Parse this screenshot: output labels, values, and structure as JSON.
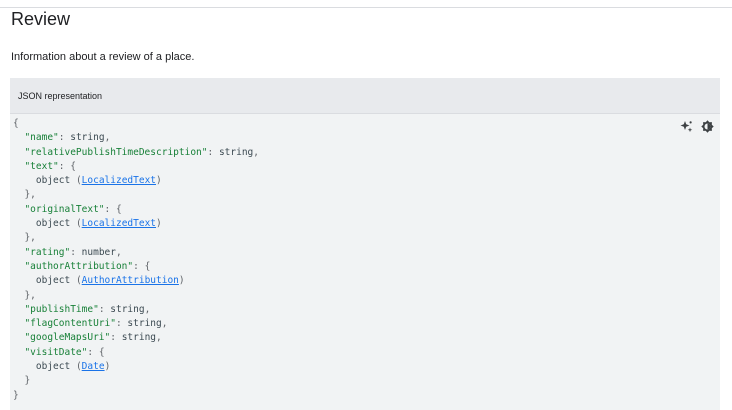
{
  "page": {
    "title": "Review",
    "description": "Information about a review of a place."
  },
  "panel": {
    "header": "JSON representation",
    "tools": [
      {
        "icon": "sparkle-icon"
      },
      {
        "icon": "dark-mode-toggle-icon"
      }
    ],
    "code": {
      "open_brace": "{",
      "close_brace": "}",
      "fields": {
        "name": {
          "key": "\"name\"",
          "type": "string"
        },
        "relativePublishTimeDescription": {
          "key": "\"relativePublishTimeDescription\"",
          "type": "string"
        },
        "text": {
          "key": "\"text\"",
          "object_word": "object",
          "link": "LocalizedText"
        },
        "originalText": {
          "key": "\"originalText\"",
          "object_word": "object",
          "link": "LocalizedText"
        },
        "rating": {
          "key": "\"rating\"",
          "type": "number"
        },
        "authorAttribution": {
          "key": "\"authorAttribution\"",
          "object_word": "object",
          "link": "AuthorAttribution"
        },
        "publishTime": {
          "key": "\"publishTime\"",
          "type": "string"
        },
        "flagContentUri": {
          "key": "\"flagContentUri\"",
          "type": "string"
        },
        "googleMapsUri": {
          "key": "\"googleMapsUri\"",
          "type": "string"
        },
        "visitDate": {
          "key": "\"visitDate\"",
          "object_word": "object",
          "link": "Date"
        }
      }
    }
  }
}
